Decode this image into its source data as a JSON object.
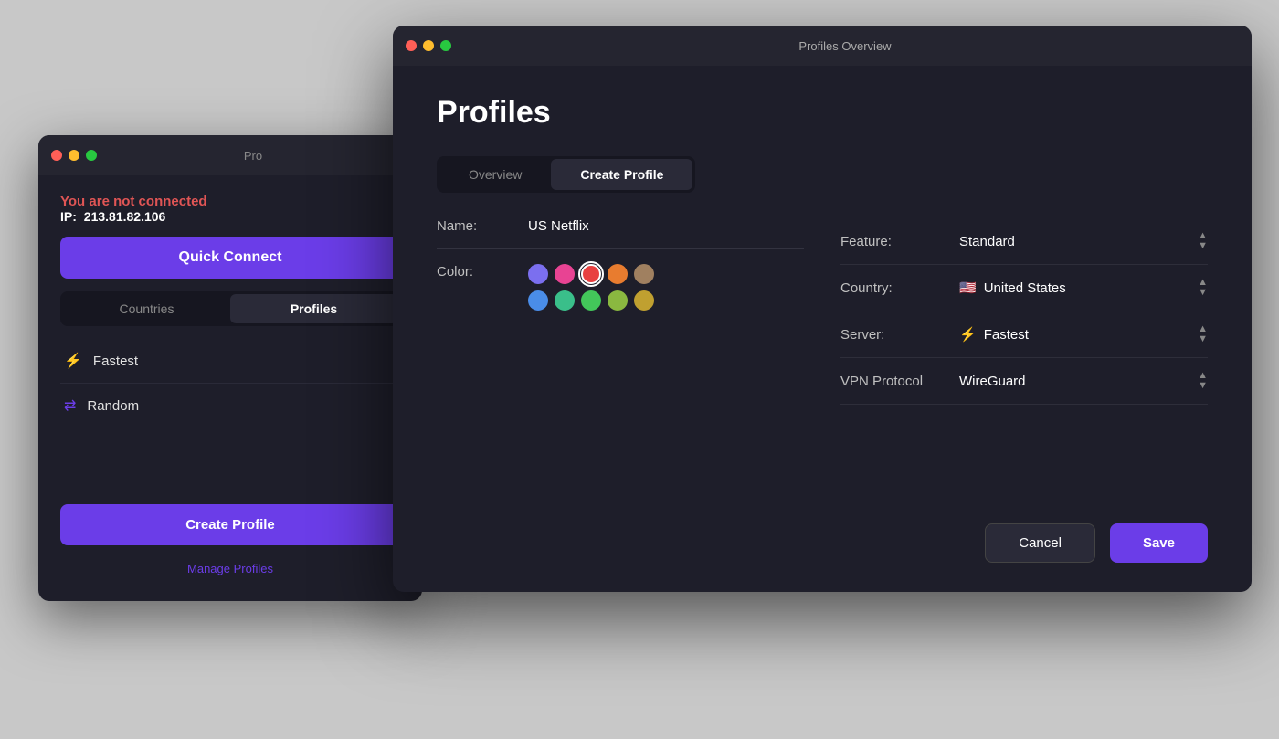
{
  "bgWindow": {
    "titlebar": {
      "text": "Pro"
    },
    "status": {
      "notConnected": "You are not connected",
      "ipLabel": "IP:",
      "ipValue": "213.81.82.106"
    },
    "quickConnectBtn": "Quick Connect",
    "tabs": [
      {
        "label": "Countries",
        "active": false
      },
      {
        "label": "Profiles",
        "active": true
      }
    ],
    "profileItems": [
      {
        "icon": "⚡",
        "label": "Fastest"
      },
      {
        "icon": "⇄",
        "label": "Random"
      }
    ],
    "createProfileBtn": "Create Profile",
    "manageProfilesLink": "Manage Profiles"
  },
  "fgWindow": {
    "titlebar": {
      "text": "Profiles Overview"
    },
    "pageTitle": "Profiles",
    "tabs": [
      {
        "label": "Overview",
        "active": false
      },
      {
        "label": "Create Profile",
        "active": true
      }
    ],
    "form": {
      "nameLabel": "Name:",
      "nameValue": "US Netflix",
      "featureLabel": "Feature:",
      "featureValue": "Standard",
      "colorLabel": "Color:",
      "colors": [
        {
          "hex": "#7b6fef",
          "selected": false
        },
        {
          "hex": "#e84393",
          "selected": false
        },
        {
          "hex": "#e84040",
          "selected": true
        },
        {
          "hex": "#e87c2f",
          "selected": false
        },
        {
          "hex": "#a08060",
          "selected": false
        },
        {
          "hex": "#4a8de8",
          "selected": false
        },
        {
          "hex": "#3abf8a",
          "selected": false
        },
        {
          "hex": "#43c65a",
          "selected": false
        },
        {
          "hex": "#8ab840",
          "selected": false
        },
        {
          "hex": "#c0a030",
          "selected": false
        }
      ],
      "countryLabel": "Country:",
      "countryFlag": "🇺🇸",
      "countryValue": "United States",
      "serverLabel": "Server:",
      "serverIcon": "⚡",
      "serverValue": "Fastest",
      "vpnProtocolLabel": "VPN Protocol",
      "vpnProtocolValue": "WireGuard"
    },
    "cancelBtn": "Cancel",
    "saveBtn": "Save"
  }
}
